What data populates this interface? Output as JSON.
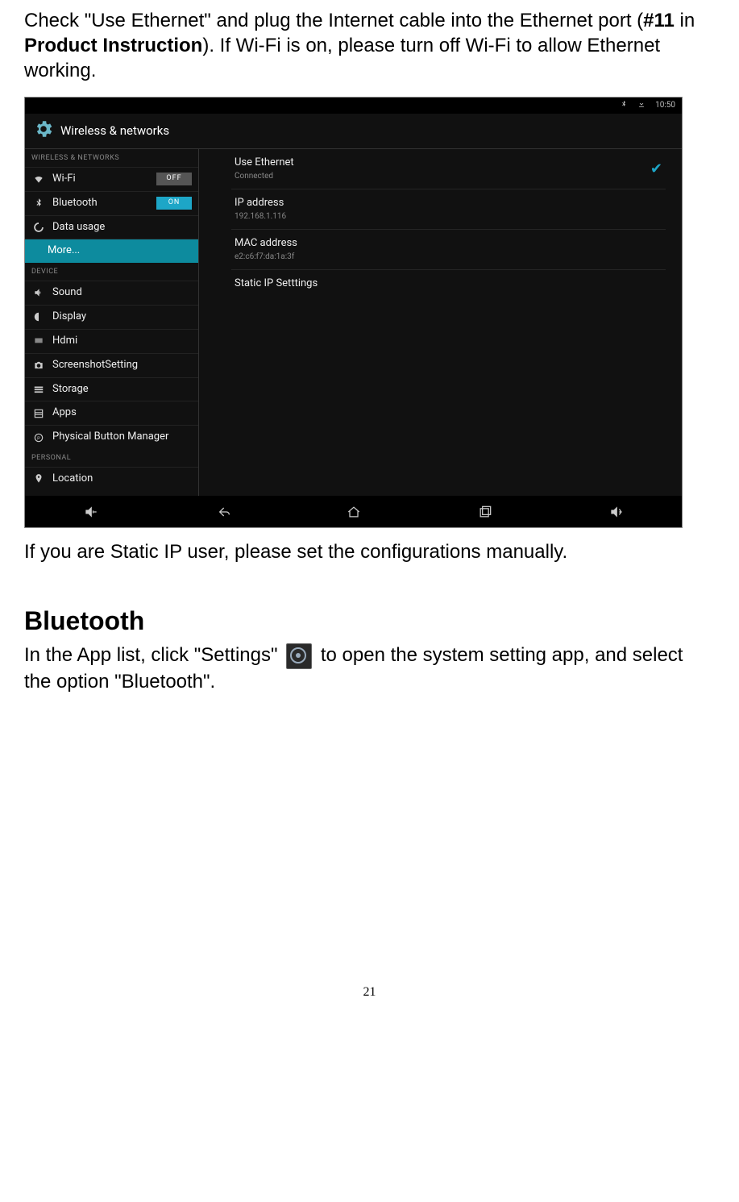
{
  "doc": {
    "para1_a": "Check \"Use Ethernet\" and plug the Internet cable into the Ethernet port (",
    "para1_b": "#11",
    "para1_c": " in ",
    "para1_d": "Product Instruction",
    "para1_e": "). If Wi-Fi is on, please turn off Wi-Fi to allow Ethernet working.",
    "after_shot": "If you are Static IP user, please set the configurations manually.",
    "heading": "Bluetooth",
    "para2_a": "In the App list, click \"Settings\" ",
    "para2_b": " to open the system setting app, and select the option \"Bluetooth\".",
    "page_number": "21"
  },
  "shot": {
    "statusbar": {
      "time": "10:50",
      "bt_icon": "bluetooth-icon",
      "dl_icon": "download-icon"
    },
    "title": "Wireless & networks",
    "sidebar_sections": {
      "wireless": "WIRELESS & NETWORKS",
      "device": "DEVICE",
      "personal": "PERSONAL"
    },
    "sidebar": {
      "wifi": {
        "label": "Wi-Fi",
        "toggle": "OFF"
      },
      "bluetooth": {
        "label": "Bluetooth",
        "toggle": "ON"
      },
      "data": {
        "label": "Data usage"
      },
      "more": {
        "label": "More..."
      },
      "sound": {
        "label": "Sound"
      },
      "display": {
        "label": "Display"
      },
      "hdmi": {
        "label": "Hdmi"
      },
      "screenshot": {
        "label": "ScreenshotSetting"
      },
      "storage": {
        "label": "Storage"
      },
      "apps": {
        "label": "Apps"
      },
      "physbtn": {
        "label": "Physical Button Manager"
      },
      "location": {
        "label": "Location"
      }
    },
    "content": {
      "use_eth": {
        "primary": "Use Ethernet",
        "secondary": "Connected"
      },
      "ip": {
        "primary": "IP address",
        "secondary": "192.168.1.116"
      },
      "mac": {
        "primary": "MAC address",
        "secondary": "e2:c6:f7:da:1a:3f"
      },
      "static_ip": {
        "primary": "Static IP Setttings"
      }
    }
  }
}
